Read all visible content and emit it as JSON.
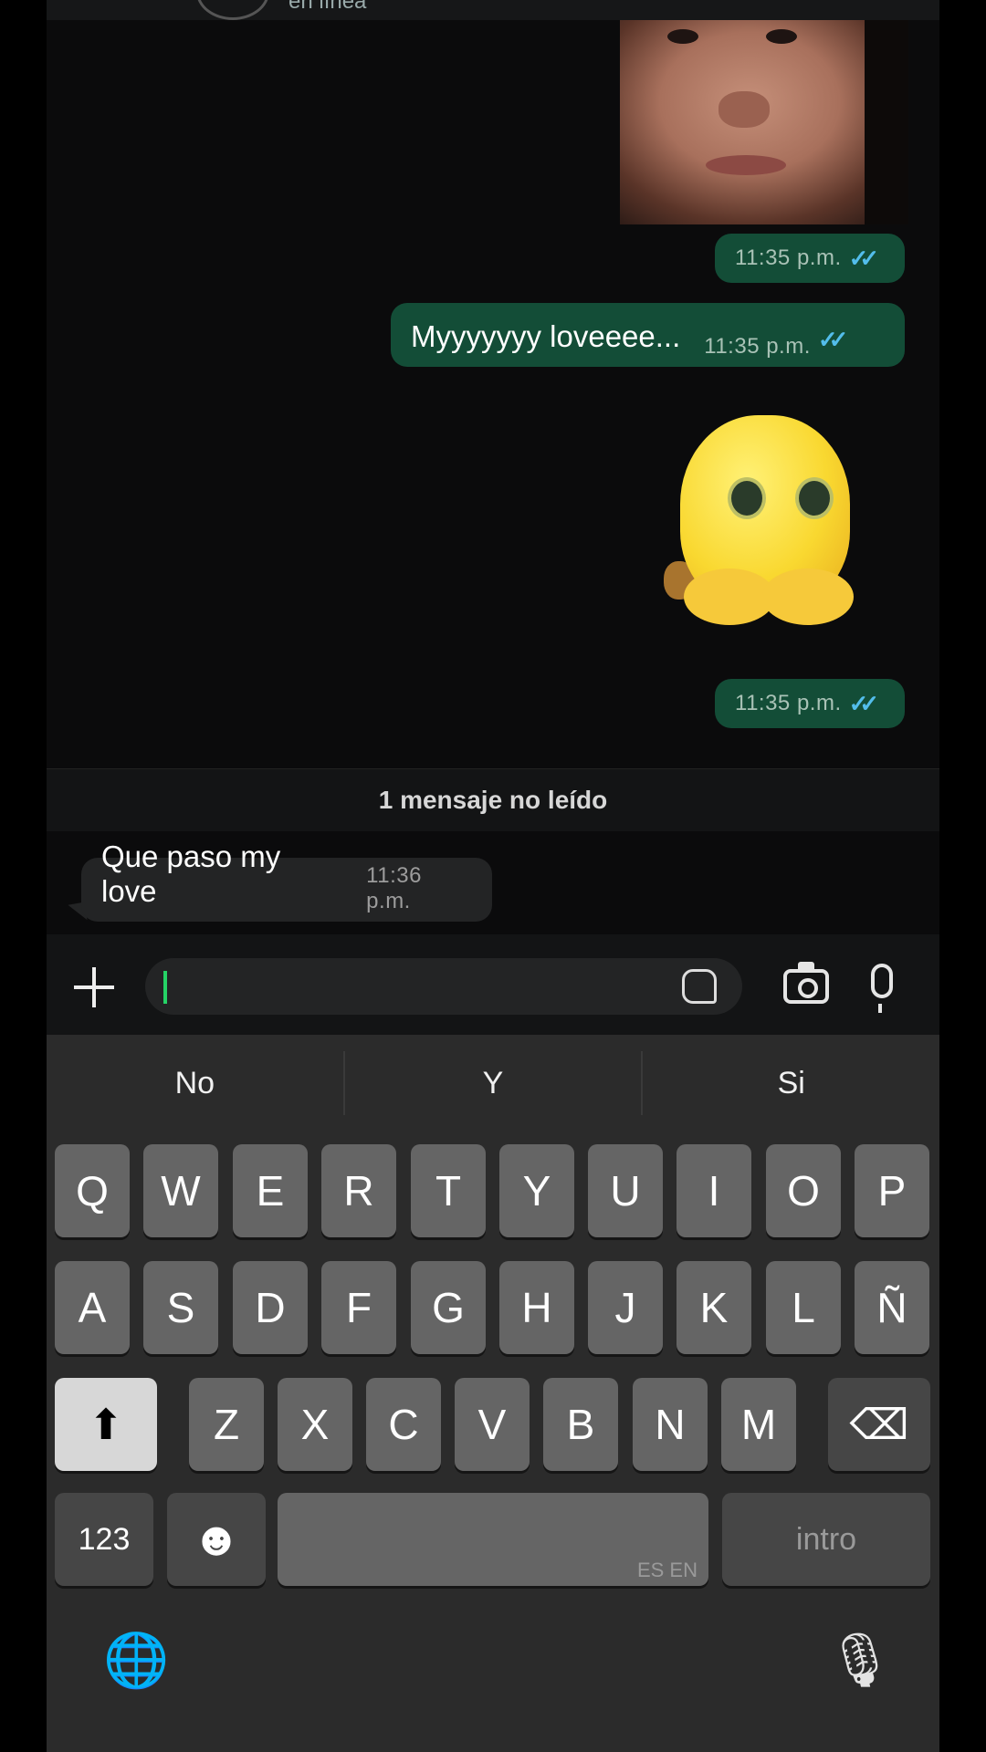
{
  "header": {
    "status": "en línea"
  },
  "messages": {
    "photo_ts": "11:35 p.m.",
    "text_out": "Myyyyyyy loveeee...",
    "text_out_ts": "11:35 p.m.",
    "sticker_ts": "11:35 p.m.",
    "unread_banner": "1 mensaje no leído",
    "text_in": "Que paso my love",
    "text_in_ts": "11:36 p.m.",
    "read_ticks": "✓✓"
  },
  "composer": {
    "value": ""
  },
  "keyboard": {
    "suggestions": [
      "No",
      "Y",
      "Si"
    ],
    "row1": [
      "Q",
      "W",
      "E",
      "R",
      "T",
      "Y",
      "U",
      "I",
      "O",
      "P"
    ],
    "row2": [
      "A",
      "S",
      "D",
      "F",
      "G",
      "H",
      "J",
      "K",
      "L",
      "Ñ"
    ],
    "row3": [
      "Z",
      "X",
      "C",
      "V",
      "B",
      "N",
      "M"
    ],
    "numbers_key": "123",
    "space_langs": "ES EN",
    "intro_key": "intro",
    "shift_icon": "⬆",
    "delete_icon": "⌫",
    "emoji_icon": "☻",
    "globe_icon": "🌐",
    "mic_icon": "🎙"
  },
  "colors": {
    "outgoing": "#134d37",
    "incoming": "#232425",
    "ticks": "#53bdeb",
    "caret": "#25d366"
  }
}
